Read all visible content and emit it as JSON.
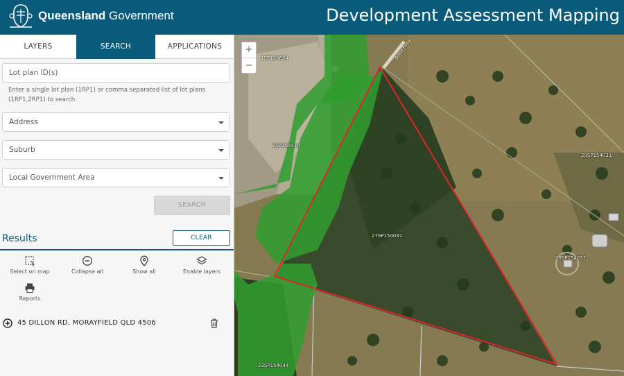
{
  "header": {
    "brand_bold": "Queensland",
    "brand_regular": " Government",
    "app_title": "Development Assessment Mapping"
  },
  "tabs": [
    {
      "label": "LAYERS",
      "active": false
    },
    {
      "label": "SEARCH",
      "active": true
    },
    {
      "label": "APPLICATIONS",
      "active": false
    }
  ],
  "search": {
    "lot_placeholder": "Lot plan ID(s)",
    "help_text": "Enter a single lot plan (1RP1) or comma separated list of lot plans (1RP1,2RP1) to search",
    "address_label": "Address",
    "suburb_label": "Suburb",
    "lga_label": "Local Government Area",
    "search_button": "SEARCH"
  },
  "results": {
    "title": "Results",
    "clear_button": "CLEAR",
    "tools": [
      {
        "label": "Select on map",
        "icon": "select-area-icon"
      },
      {
        "label": "Collapse all",
        "icon": "collapse-icon"
      },
      {
        "label": "Show all",
        "icon": "map-pin-icon"
      },
      {
        "label": "Enable layers",
        "icon": "layers-icon"
      },
      {
        "label": "Reports",
        "icon": "printer-icon"
      }
    ],
    "items": [
      {
        "address": "45 DILLON RD, MORAYFIELD QLD 4506"
      }
    ]
  },
  "map": {
    "zoom_in": "+",
    "zoom_out": "−",
    "road_label": "Dillon Road",
    "lots": [
      "1SP138634",
      "2SP154414",
      "29SP154031",
      "27SP154031",
      "28SP154031",
      "23SP154044"
    ],
    "colors": {
      "brand": "#0a5a7a",
      "parcel_outline": "#e0242a",
      "overlay_green": "#2f9e2f"
    }
  }
}
